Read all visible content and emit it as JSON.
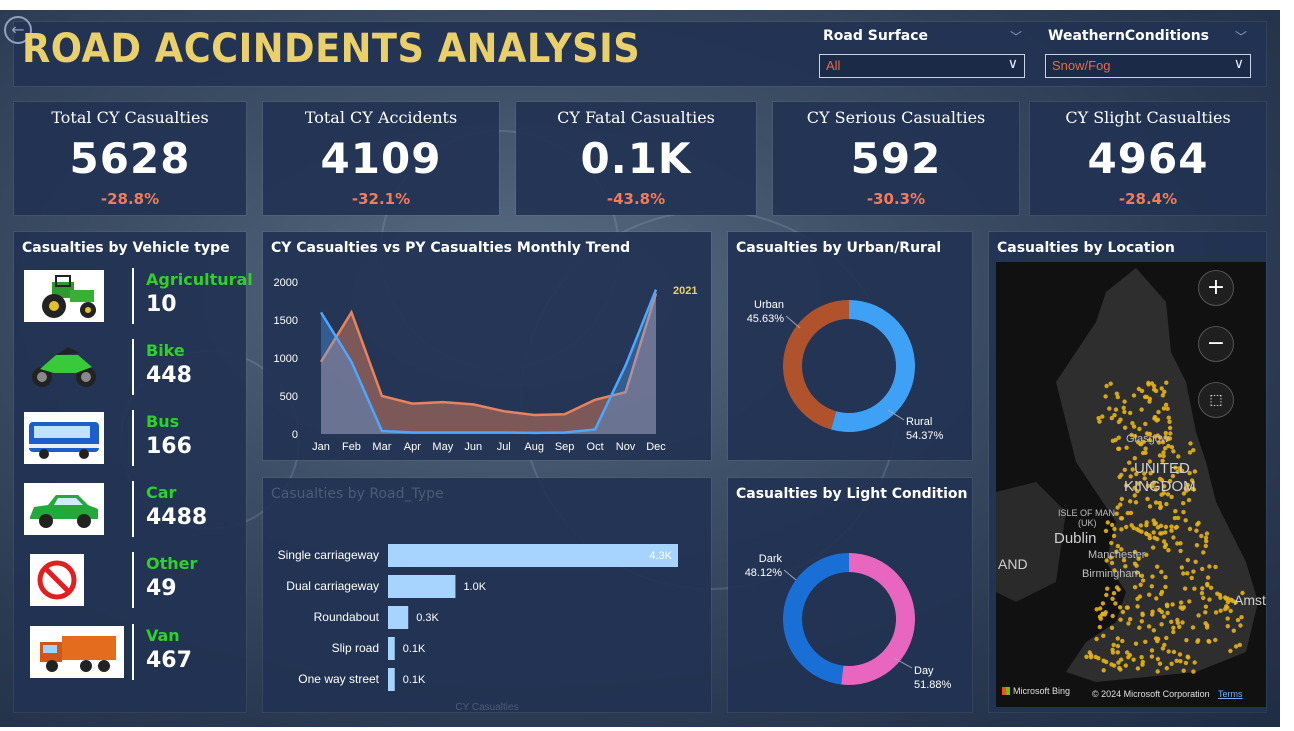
{
  "header": {
    "title": "ROAD ACCINDENTS ANALYSIS",
    "back_icon": "back-arrow-icon"
  },
  "slicers": [
    {
      "label": "Road Surface",
      "value": "All"
    },
    {
      "label": "WeathernConditions",
      "value": "Snow/Fog"
    }
  ],
  "kpis": [
    {
      "title": "Total CY Casualties",
      "value": "5628",
      "delta": "-28.8%"
    },
    {
      "title": "Total CY Accidents",
      "value": "4109",
      "delta": "-32.1%"
    },
    {
      "title": "CY Fatal Casualties",
      "value": "0.1K",
      "delta": "-43.8%"
    },
    {
      "title": "CY Serious Casualties",
      "value": "592",
      "delta": "-30.3%"
    },
    {
      "title": "CY Slight Casualties",
      "value": "4964",
      "delta": "-28.4%"
    }
  ],
  "vehicles": {
    "title": "Casualties by Vehicle type",
    "items": [
      {
        "name": "Agricultural",
        "value": "10",
        "icon": "tractor-icon"
      },
      {
        "name": "Bike",
        "value": "448",
        "icon": "motorbike-icon"
      },
      {
        "name": "Bus",
        "value": "166",
        "icon": "bus-icon"
      },
      {
        "name": "Car",
        "value": "4488",
        "icon": "car-icon"
      },
      {
        "name": "Other",
        "value": "49",
        "icon": "no-entry-icon"
      },
      {
        "name": "Van",
        "value": "467",
        "icon": "truck-icon"
      }
    ]
  },
  "chart_data": [
    {
      "type": "area",
      "title": "CY Casualties vs PY Casualties Monthly Trend",
      "categories": [
        "Jan",
        "Feb",
        "Mar",
        "Apr",
        "May",
        "Jun",
        "Jul",
        "Aug",
        "Sep",
        "Oct",
        "Nov",
        "Dec"
      ],
      "ylim": [
        0,
        2000
      ],
      "yticks": [
        0,
        500,
        1000,
        1500,
        2000
      ],
      "annotation": "2021",
      "series": [
        {
          "color": "#e8825f",
          "values": [
            950,
            1600,
            500,
            400,
            420,
            390,
            300,
            250,
            260,
            450,
            550,
            1850
          ]
        },
        {
          "color": "#4ea6ff",
          "values": [
            1600,
            950,
            40,
            20,
            20,
            20,
            20,
            15,
            20,
            60,
            900,
            1900
          ]
        }
      ]
    },
    {
      "type": "pie",
      "title": "Casualties by Urban/Rural",
      "labels": [
        "Urban",
        "Rural"
      ],
      "values": [
        45.63,
        54.37
      ],
      "display": [
        "45.63%",
        "54.37%"
      ],
      "colors": [
        "#b0532c",
        "#3ea1f5"
      ]
    },
    {
      "type": "bar",
      "title": "Casualties by Road_Type",
      "categories": [
        "Single carriageway",
        "Dual carriageway",
        "Roundabout",
        "Slip road",
        "One way street"
      ],
      "values": [
        4300,
        1000,
        300,
        100,
        100
      ],
      "labels": [
        "4.3K",
        "1.0K",
        "0.3K",
        "0.1K",
        "0.1K"
      ],
      "xlabel": "CY Casualties",
      "color": "#a6d4ff"
    },
    {
      "type": "pie",
      "title": "Casualties by Light Condition",
      "labels": [
        "Dark",
        "Day"
      ],
      "values": [
        48.12,
        51.88
      ],
      "display": [
        "48.12%",
        "51.88%"
      ],
      "colors": [
        "#1a6fd6",
        "#e866c0"
      ]
    }
  ],
  "map": {
    "title": "Casualties by Location",
    "labels": {
      "glasgow": "Glasgow",
      "united": "UNITED",
      "kingdom": "KINGDOM",
      "isle": "ISLE OF MAN",
      "uk": "(UK)",
      "dublin": "Dublin",
      "manchester": "Manchester",
      "birmingham": "Birmingham",
      "and": "AND",
      "amste": "Amste"
    },
    "zoom_in": "+",
    "zoom_out": "−",
    "bing": "Microsoft Bing",
    "copyright": "© 2024 Microsoft Corporation",
    "terms": "Terms",
    "point_color": "#e6b21a"
  }
}
